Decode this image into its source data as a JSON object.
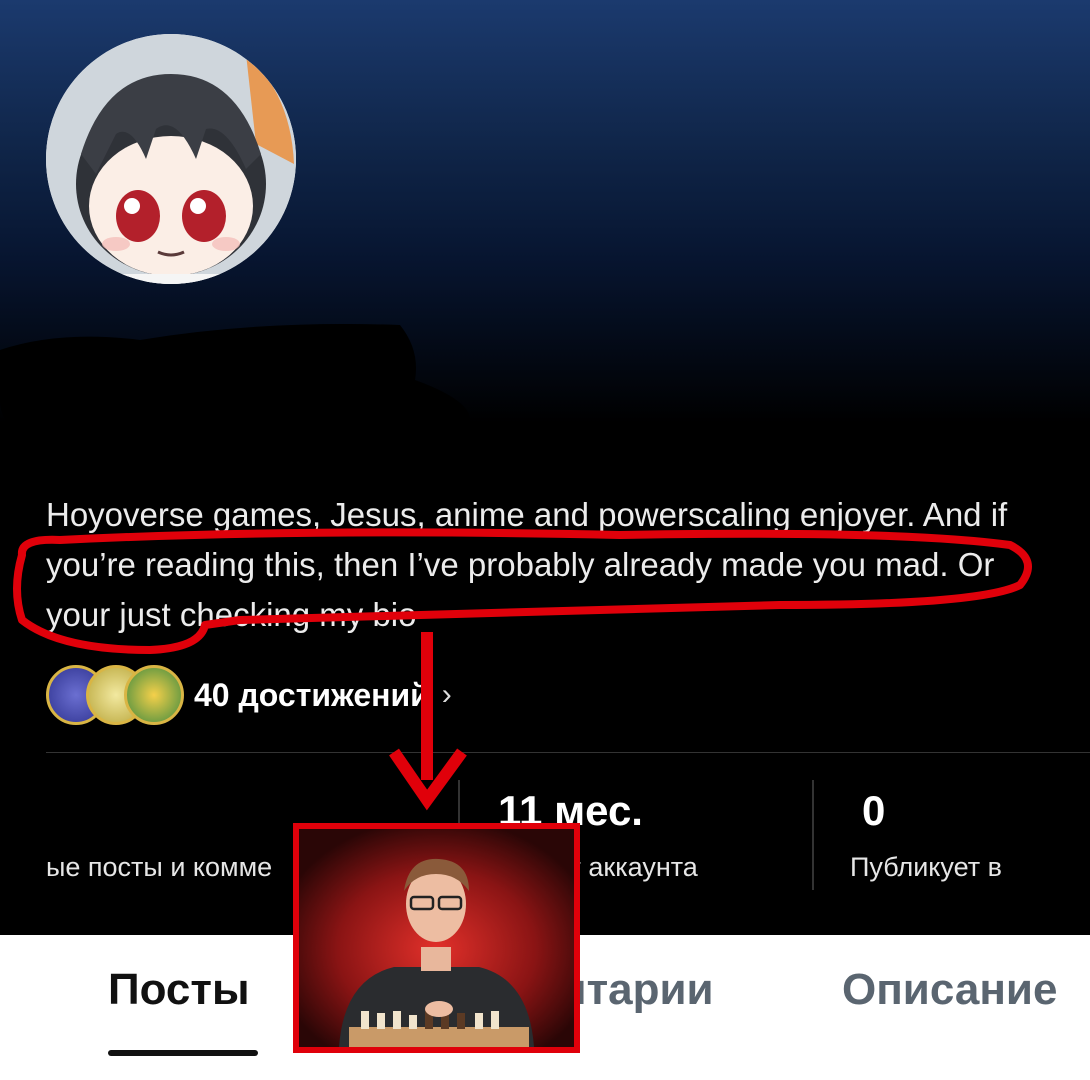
{
  "profile": {
    "bio": "Hoyoverse games, Jesus, anime and powerscaling enjoyer. And if you’re reading this, then I’ve probably already made you mad. Or your just checking my bio"
  },
  "achievements": {
    "label": "40 достижений"
  },
  "stats": [
    {
      "value": "",
      "label": "ые посты и комме"
    },
    {
      "value": "11 мес.",
      "label": "аст аккаунта"
    },
    {
      "value": "0",
      "label": "Публикует в"
    }
  ],
  "tabs": [
    {
      "label": "Посты"
    },
    {
      "label": "нтарии"
    },
    {
      "label": "Описание"
    }
  ],
  "colors": {
    "annotation": "#e0000a",
    "active_tab": "#111111",
    "inactive_tab": "#5a6570"
  }
}
